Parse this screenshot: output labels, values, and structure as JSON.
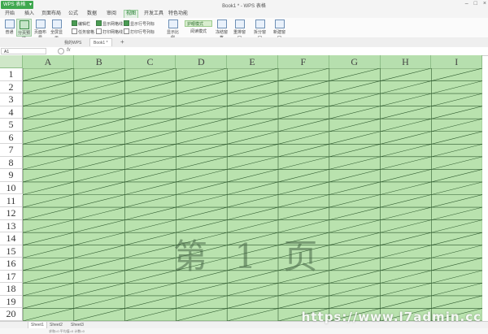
{
  "app": {
    "app_button": "WPS 表格",
    "window_title": "Book1 * - WPS 表格"
  },
  "menu": {
    "tabs": [
      "开始",
      "插入",
      "页面布局",
      "公式",
      "数据",
      "审阅",
      "视图",
      "开发工具",
      "特色功能"
    ],
    "active": "视图"
  },
  "ribbon": {
    "buttons": [
      "普通",
      "分页预览",
      "页面布局",
      "全屏显示",
      "阅读模式",
      "显示比例",
      "冻结窗格",
      "重排窗口",
      "拆分窗口",
      "新建窗口"
    ],
    "checks_col1": [
      "编辑栏",
      "任务窗格"
    ],
    "checks_col2": [
      "显示网格线",
      "打印网格线"
    ],
    "checks_col3": [
      "显示行号列标",
      "打印行号列标"
    ],
    "highlight": "护眼模式"
  },
  "doc_tabs": [
    "我的WPS",
    "Book1 *"
  ],
  "formula_bar": {
    "cell_ref": "A1",
    "fx": "fx"
  },
  "grid": {
    "columns": [
      "A",
      "B",
      "C",
      "D",
      "E",
      "F",
      "G",
      "H",
      "I"
    ],
    "rows": [
      "1",
      "2",
      "3",
      "4",
      "5",
      "6",
      "7",
      "8",
      "9",
      "10",
      "11",
      "12",
      "13",
      "14",
      "15",
      "16",
      "17",
      "18",
      "19",
      "20"
    ],
    "page_watermark": "第 1 页"
  },
  "sheet_tabs": [
    "Sheet1",
    "Sheet2",
    "Sheet3"
  ],
  "status": "求和=0  平均值=0  计数=0",
  "colors": {
    "grid_fill": "#b9e2ae",
    "header_fill": "#b6dfae",
    "line": "#2e5a2e",
    "accent": "#3fa84f"
  },
  "site_watermark": "https://www.l7admin.cc"
}
